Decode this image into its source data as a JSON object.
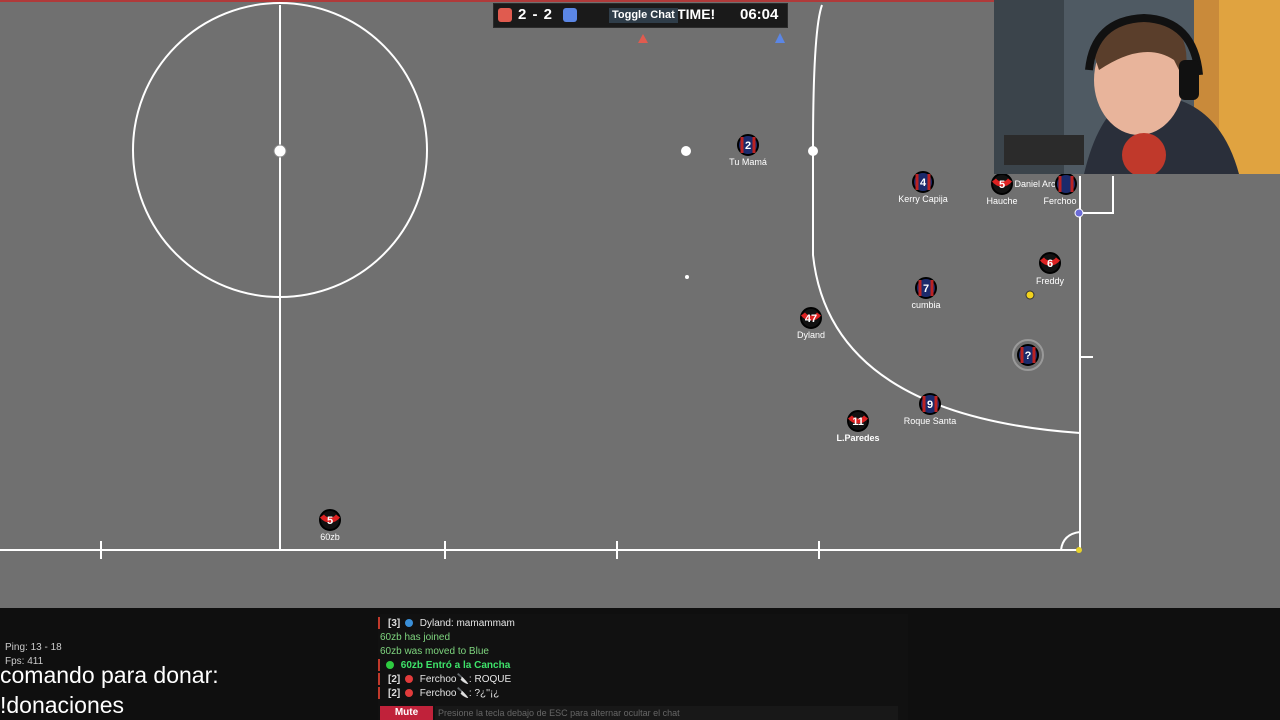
{
  "scoreboard": {
    "red_color": "#e05b4f",
    "blue_color": "#5b86e5",
    "score": "2 - 2",
    "toggle_chat_label": "Toggle Chat",
    "overtime_fragment": "RTIME!",
    "clock": "06:04"
  },
  "players": [
    {
      "number": "2",
      "name": "Tu Mamá",
      "team": "blue"
    },
    {
      "number": "4",
      "name": "Kerry Capija",
      "team": "blue"
    },
    {
      "number": "5",
      "name": "Hauche",
      "team": "red"
    },
    {
      "number": "",
      "name": "Daniel Arc",
      "team": "red"
    },
    {
      "number": "",
      "name": "Ferchoo",
      "team": "blue"
    },
    {
      "number": "6",
      "name": "Freddy",
      "team": "red"
    },
    {
      "number": "7",
      "name": "cumbia",
      "team": "blue"
    },
    {
      "number": "47",
      "name": "Dyland",
      "team": "red"
    },
    {
      "number": "?",
      "name": "",
      "team": "blue"
    },
    {
      "number": "9",
      "name": "Roque Santa",
      "team": "blue"
    },
    {
      "number": "11",
      "name": "L.Paredes",
      "team": "red"
    },
    {
      "number": "5",
      "name": "60zb",
      "team": "red"
    }
  ],
  "stats": {
    "ping": "Ping: 13 - 18",
    "fps": "Fps: 411"
  },
  "overlay": {
    "donate_line1": "comando para donar:",
    "donate_line2": "!donaciones"
  },
  "chat": {
    "messages": [
      {
        "prefix": "[3]",
        "dot": "#3a8fd8",
        "text": "Dyland: mamammam",
        "color": "#e6e6e6"
      },
      {
        "prefix": "",
        "dot": "",
        "text": "60zb has joined",
        "color": "#7fd67f"
      },
      {
        "prefix": "",
        "dot": "",
        "text": "60zb was moved to Blue",
        "color": "#7fd67f"
      },
      {
        "prefix": "",
        "dot": "#2ecc40",
        "text": "60zb Entró a la Cancha",
        "color": "#3ee36a"
      },
      {
        "prefix": "[2]",
        "dot": "#e23b3b",
        "text": "Ferchoo🔪: ROQUE",
        "color": "#e6e6e6"
      },
      {
        "prefix": "[2]",
        "dot": "#e23b3b",
        "text": "Ferchoo🔪: ?¿''¡¿",
        "color": "#e6e6e6"
      }
    ],
    "mute_label": "Mute",
    "input_placeholder": "Presione la tecla debajo de ESC para alternar ocultar el chat"
  }
}
